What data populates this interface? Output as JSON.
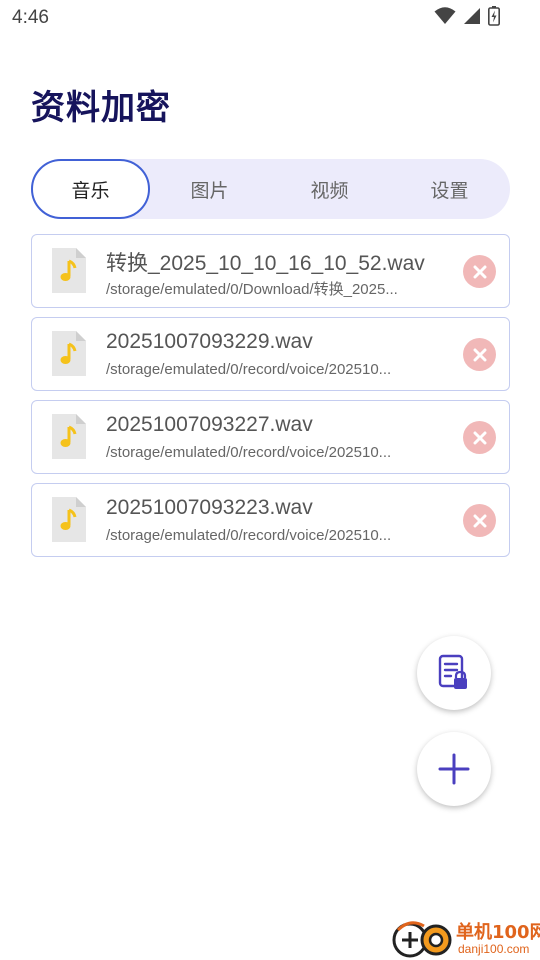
{
  "status_bar": {
    "time": "4:46"
  },
  "header": {
    "title": "资料加密"
  },
  "tabs": [
    {
      "label": "音乐",
      "active": true
    },
    {
      "label": "图片",
      "active": false
    },
    {
      "label": "视频",
      "active": false
    },
    {
      "label": "设置",
      "active": false
    }
  ],
  "files": [
    {
      "name": "转换_2025_10_10_16_10_52.wav",
      "path": "/storage/emulated/0/Download/转换_2025..."
    },
    {
      "name": "20251007093229.wav",
      "path": "/storage/emulated/0/record/voice/202510..."
    },
    {
      "name": "20251007093227.wav",
      "path": "/storage/emulated/0/record/voice/202510..."
    },
    {
      "name": "20251007093223.wav",
      "path": "/storage/emulated/0/record/voice/202510..."
    }
  ],
  "icons": {
    "file": "music-file-icon",
    "delete": "close-circle-icon",
    "encrypted_list": "locked-document-icon",
    "add": "plus-icon"
  },
  "colors": {
    "accent": "#4161d6",
    "title": "#16145c",
    "tab_bg": "#ecebfb",
    "delete": "#f1b8b8",
    "music_note": "#f5c21b",
    "fab_icon": "#4a3fbf"
  },
  "watermark": {
    "title": "单机100网",
    "url": "danji100.com"
  }
}
